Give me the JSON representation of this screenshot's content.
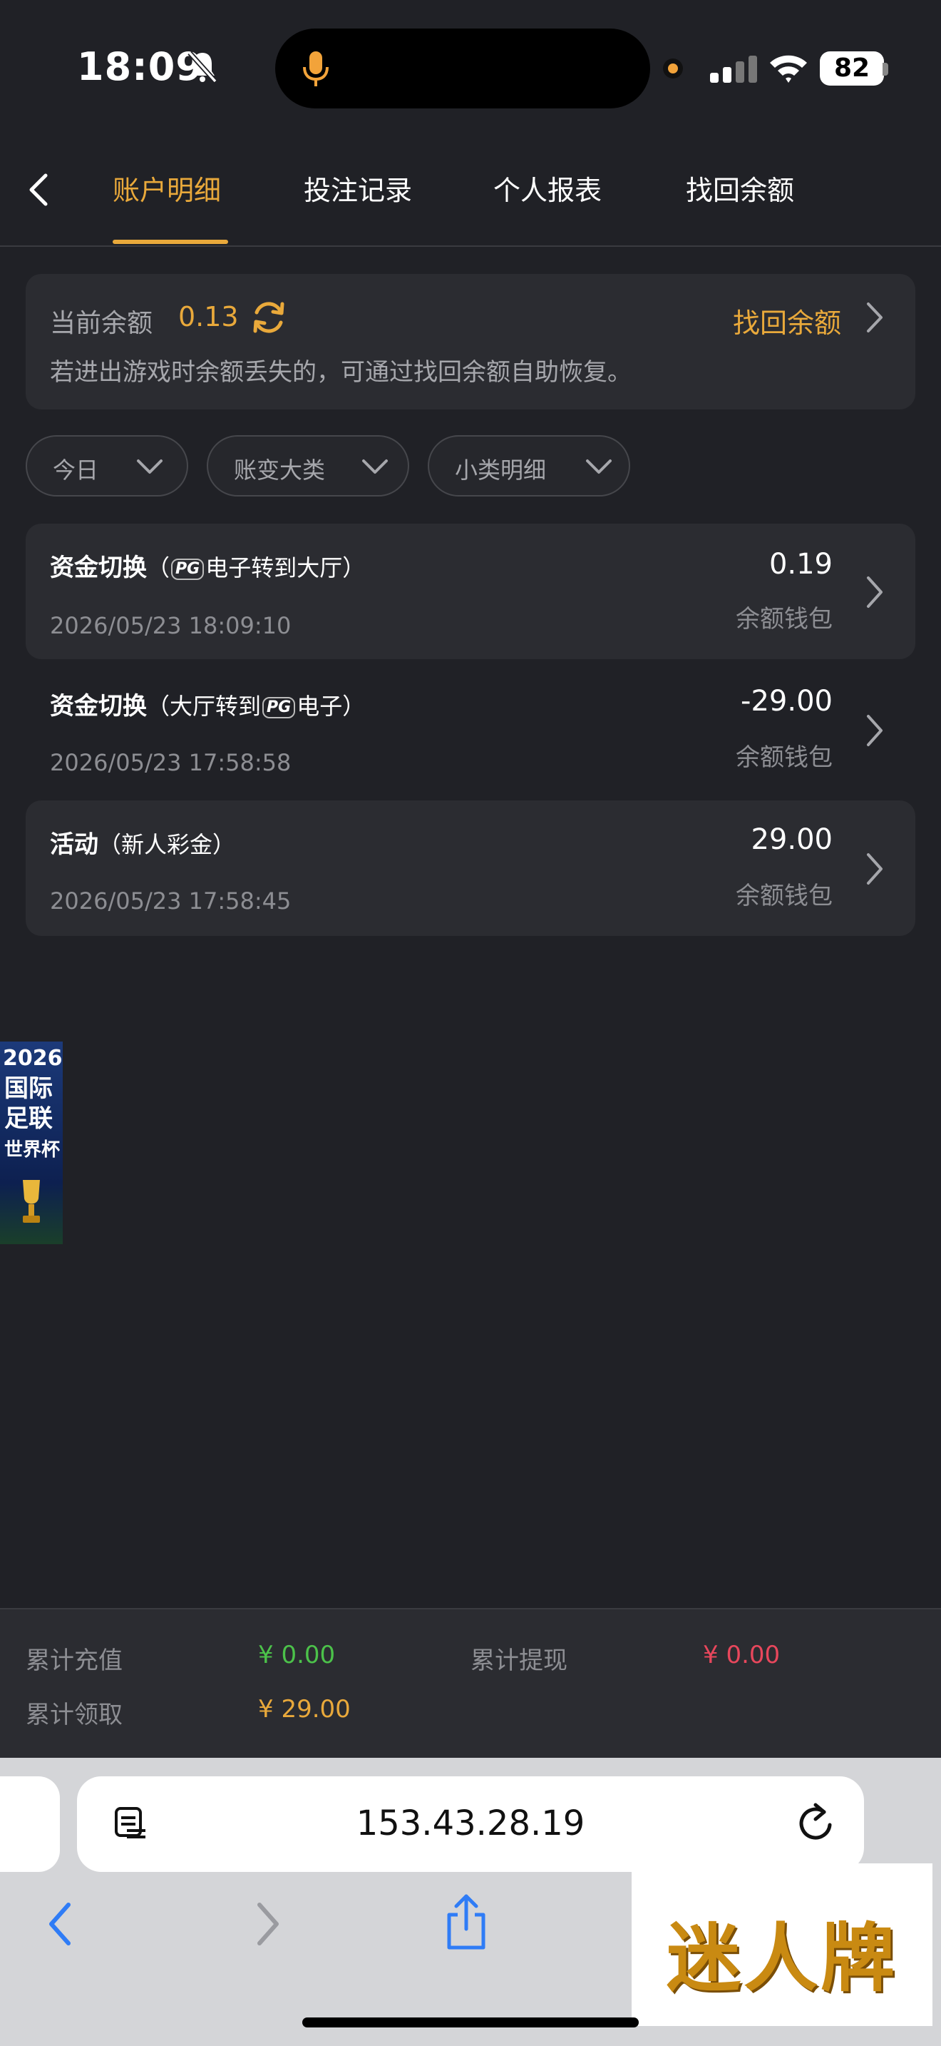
{
  "status_bar": {
    "time": "18:09",
    "battery": "82"
  },
  "nav": {
    "tabs": [
      {
        "label": "账户明细",
        "active": true
      },
      {
        "label": "投注记录",
        "active": false
      },
      {
        "label": "个人报表",
        "active": false
      },
      {
        "label": "找回余额",
        "active": false
      }
    ]
  },
  "balance": {
    "label": "当前余额",
    "value": "0.13",
    "recover_label": "找回余额",
    "hint": "若进出游戏时余额丢失的，可通过找回余额自助恢复。"
  },
  "filters": [
    {
      "label": "今日"
    },
    {
      "label": "账变大类"
    },
    {
      "label": "小类明细"
    }
  ],
  "records": [
    {
      "title": "资金切换",
      "sub_pre": "（",
      "pg": "PG",
      "sub_post": "电子转到大厅）",
      "time": "2026/05/23 18:09:10",
      "amount": "0.19",
      "wallet": "余额钱包"
    },
    {
      "title": "资金切换",
      "sub_pre": "（大厅转到",
      "pg": "PG",
      "sub_post": "电子）",
      "time": "2026/05/23 17:58:58",
      "amount": "-29.00",
      "wallet": "余额钱包"
    },
    {
      "title": "活动",
      "sub_pre": "（新人彩金）",
      "pg": "",
      "sub_post": "",
      "time": "2026/05/23 17:58:45",
      "amount": "29.00",
      "wallet": "余额钱包"
    }
  ],
  "banner": {
    "year": "2026",
    "line1": "国际",
    "line2": "足联",
    "line3": "世界杯"
  },
  "totals": {
    "recharge_label": "累计充值",
    "recharge_value": "¥ 0.00",
    "withdraw_label": "累计提现",
    "withdraw_value": "¥ 0.00",
    "claim_label": "累计领取",
    "claim_value": "¥ 29.00"
  },
  "browser": {
    "url": "153.43.28.19"
  },
  "watermark": "迷人牌",
  "colors": {
    "accent": "#e9a93b",
    "green": "#4cc24a",
    "red": "#e8475c",
    "bg": "#202126",
    "card": "#2b2c31"
  }
}
